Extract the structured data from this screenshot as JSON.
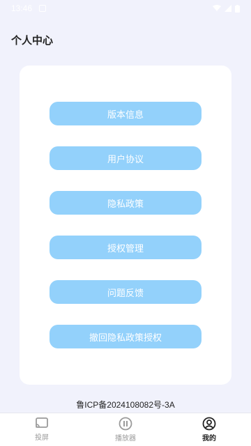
{
  "status_bar": {
    "time": "13:46"
  },
  "header": {
    "title": "个人中心"
  },
  "menu": [
    {
      "label": "版本信息"
    },
    {
      "label": "用户协议"
    },
    {
      "label": "隐私政策"
    },
    {
      "label": "授权管理"
    },
    {
      "label": "问题反馈"
    },
    {
      "label": "撤回隐私政策授权"
    }
  ],
  "footer": {
    "icp": "鲁ICP备2024108082号-3A"
  },
  "bottom_nav": [
    {
      "label": "投屏",
      "icon": "cast-icon"
    },
    {
      "label": "播放器",
      "icon": "pause-circle-icon"
    },
    {
      "label": "我的",
      "icon": "user-circle-icon",
      "active": true
    }
  ],
  "colors": {
    "accent": "#93d1fb",
    "background": "#f1f2fc"
  }
}
